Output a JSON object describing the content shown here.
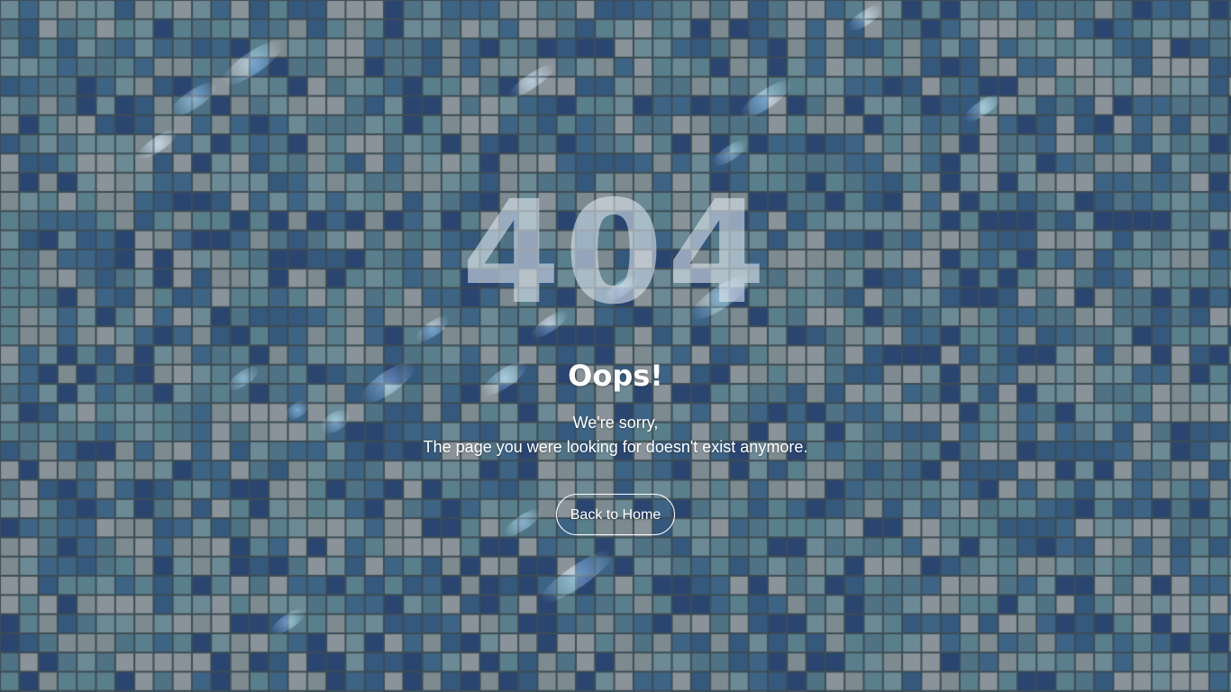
{
  "error": {
    "code": "404",
    "heading": "Oops!",
    "message_line_1": "We're sorry,",
    "message_line_2": "The page you were looking for doesn't exist anymore.",
    "button_label": "Back to Home"
  },
  "background": {
    "description": "blue pool mosaic tiles",
    "grout_color": "#3d4d55",
    "tile_colors": [
      "#2a4570",
      "#35587d",
      "#3e6485",
      "#4f7285",
      "#5a7f8c",
      "#6b8a95",
      "#8a9399",
      "#7d8a90"
    ]
  },
  "colors": {
    "text": "#ffffff",
    "code_text": "rgba(226,232,242,0.58)"
  }
}
